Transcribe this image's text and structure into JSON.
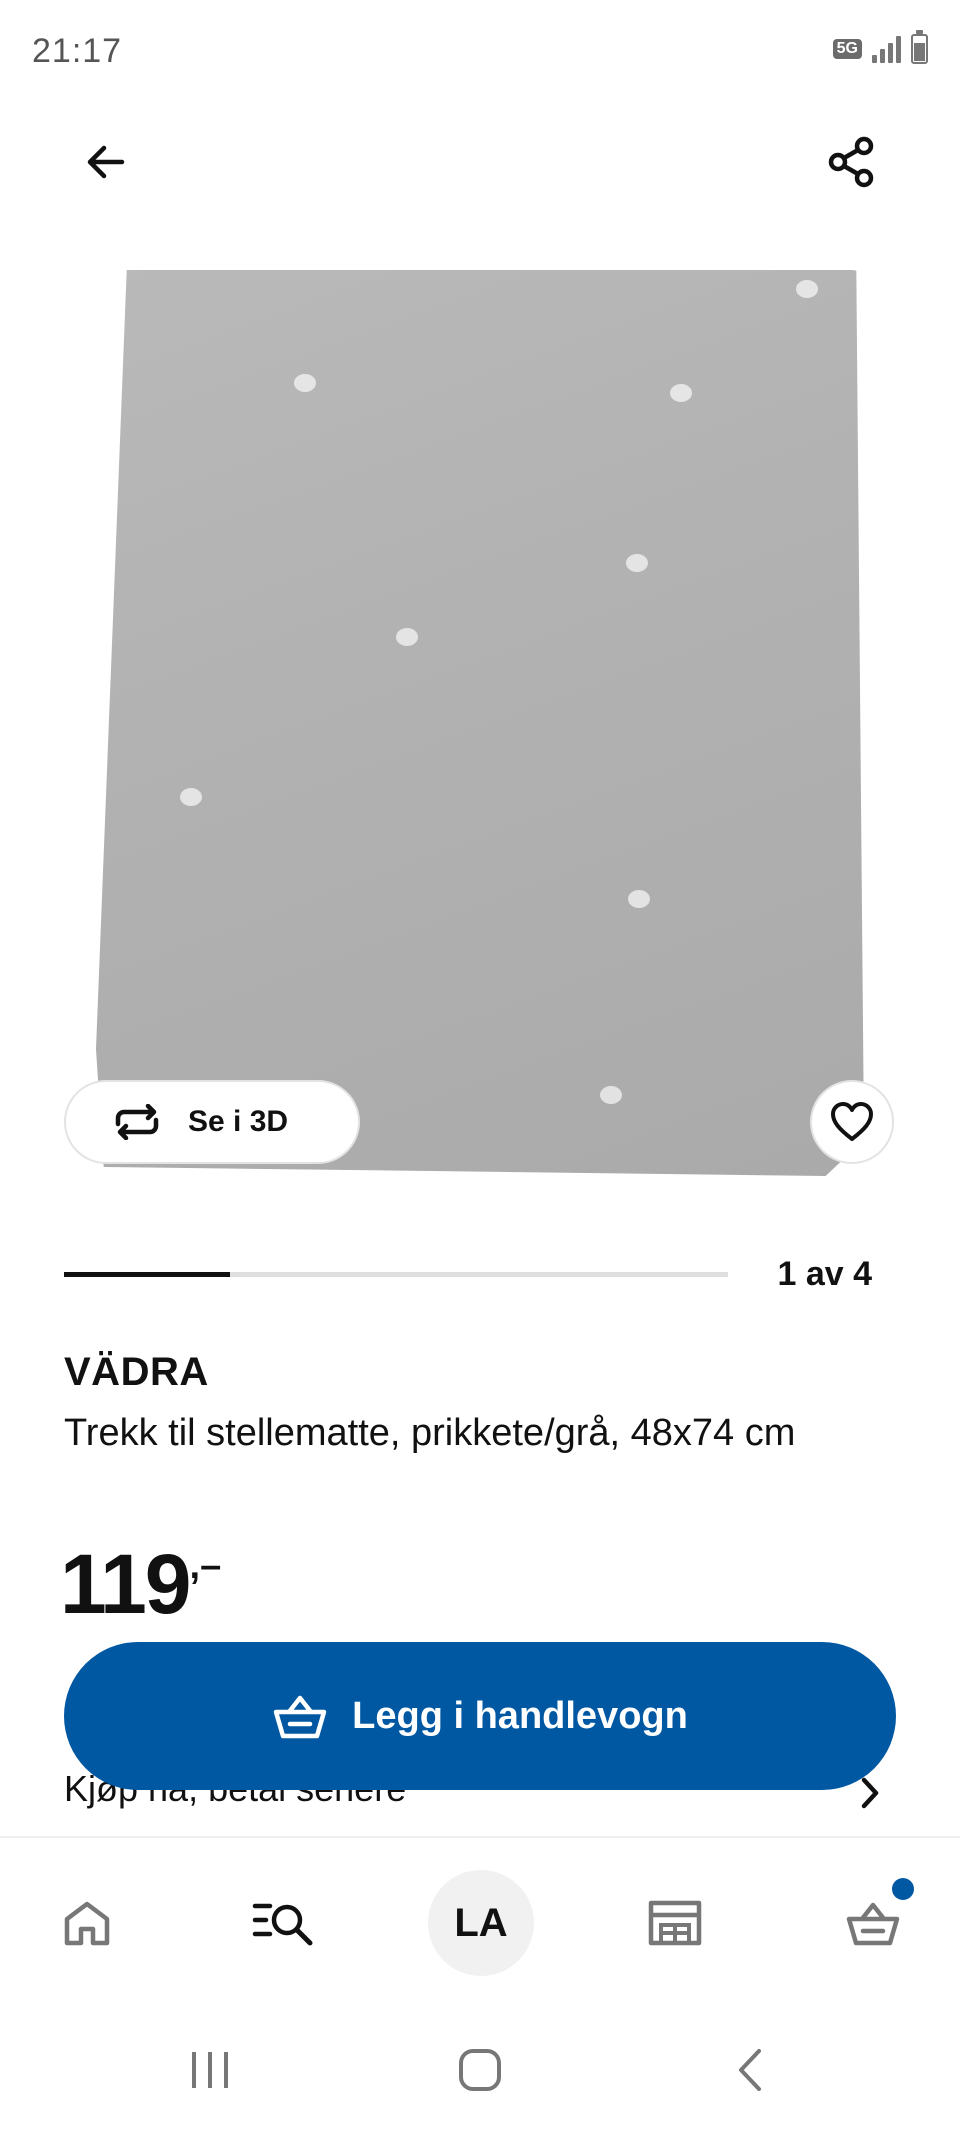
{
  "status_bar": {
    "time": "21:17",
    "network": "5G",
    "icons": [
      "network-5g-icon",
      "signal-icon",
      "battery-icon"
    ]
  },
  "top_nav": {
    "back_icon": "arrow-left-icon",
    "share_icon": "share-icon"
  },
  "gallery": {
    "view_3d_label": "Se i 3D",
    "view_3d_icon": "rotate-arrows-icon",
    "favorite_icon": "heart-icon",
    "counter": "1 av 4",
    "progress": 0.25
  },
  "product": {
    "name": "VÄDRA",
    "description": "Trekk til stellematte, prikkete/grå, 48x74 cm",
    "price_integer": "119",
    "price_suffix": ",–",
    "finance_label": "Kjøp nå, betal senere"
  },
  "cart_button": {
    "label": "Legg i handlevogn",
    "icon": "basket-icon",
    "color": "#0058a3"
  },
  "bottom_nav": {
    "items": [
      "home-icon",
      "search-list-icon",
      "profile-avatar",
      "store-icon",
      "cart-icon"
    ],
    "profile_initials": "LA",
    "cart_badge_color": "#0058a3"
  },
  "system_nav": [
    "recent-apps-icon",
    "home-circle-icon",
    "back-chevron-icon"
  ]
}
